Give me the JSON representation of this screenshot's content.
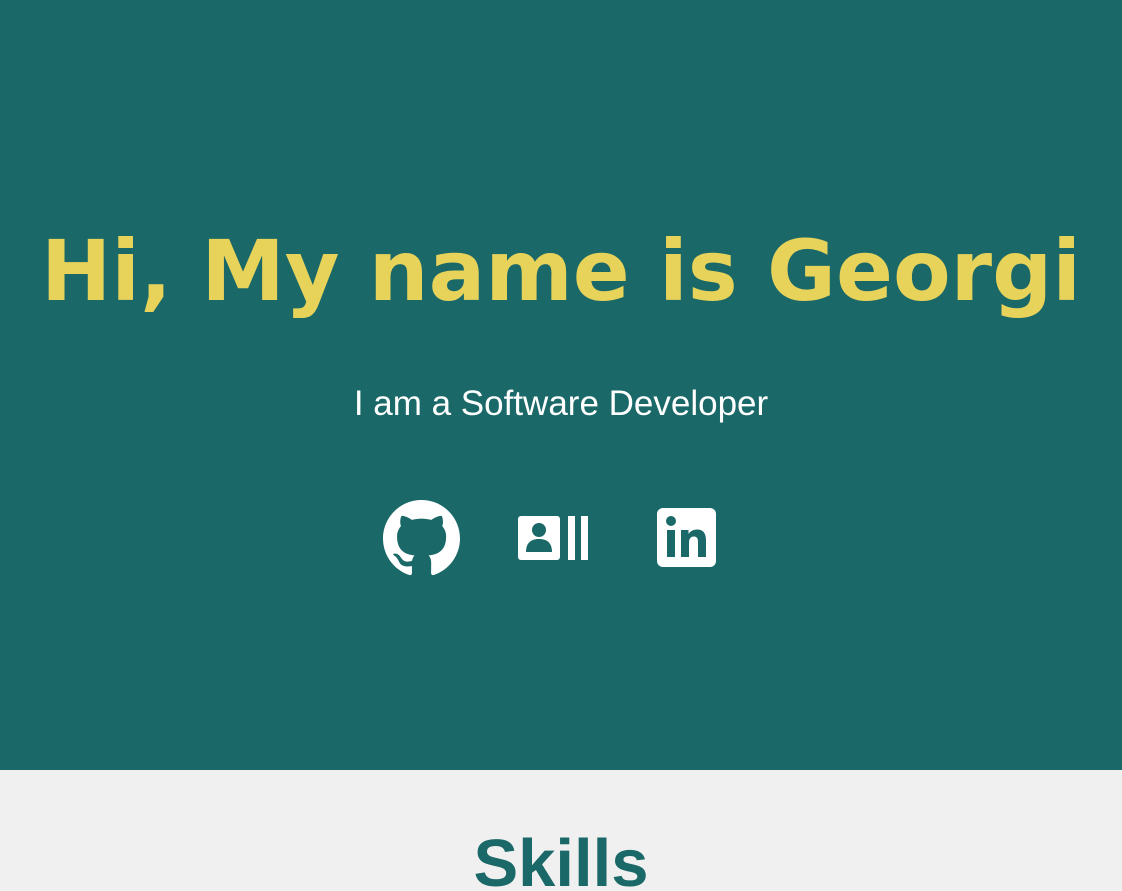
{
  "hero": {
    "title": "Hi, My name is Georgi",
    "subtitle": "I am a Software Developer",
    "background_color": "#1a6868",
    "title_color": "#e8d35a",
    "social_links": [
      {
        "name": "GitHub",
        "icon": "github-icon"
      },
      {
        "name": "Resume",
        "icon": "resume-card-icon"
      },
      {
        "name": "LinkedIn",
        "icon": "linkedin-icon"
      }
    ]
  },
  "skills": {
    "title": "Skills",
    "title_color": "#1a6868",
    "background_color": "#f0f0f0"
  }
}
